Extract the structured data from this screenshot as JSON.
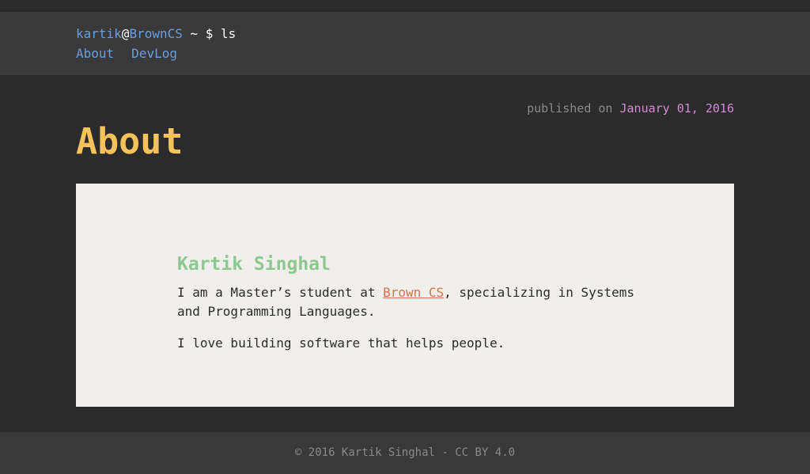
{
  "header": {
    "prompt_user": "kartik",
    "prompt_at": "@",
    "prompt_host": "BrownCS",
    "prompt_rest": " ~ $ ls",
    "nav": [
      "About",
      "DevLog"
    ]
  },
  "page": {
    "published_prefix": "published on ",
    "published_date": "January 01, 2016",
    "title": "About"
  },
  "content": {
    "name": "Kartik Singhal",
    "para1_before": "I am a Master’s student at ",
    "para1_link": "Brown CS",
    "para1_after": ", specializing in Systems and Programming Languages.",
    "para2": "I love building software that helps people."
  },
  "footer": {
    "text": "© 2016 Kartik Singhal - CC BY 4.0"
  },
  "colors": {
    "background": "#2b2b2b",
    "header_bg": "#393939",
    "link": "#6a9fdd",
    "title": "#f6c25b",
    "name": "#8dc891",
    "date": "#d58bd6",
    "inline_link": "#d2734f",
    "card_bg": "#f0efeb"
  }
}
